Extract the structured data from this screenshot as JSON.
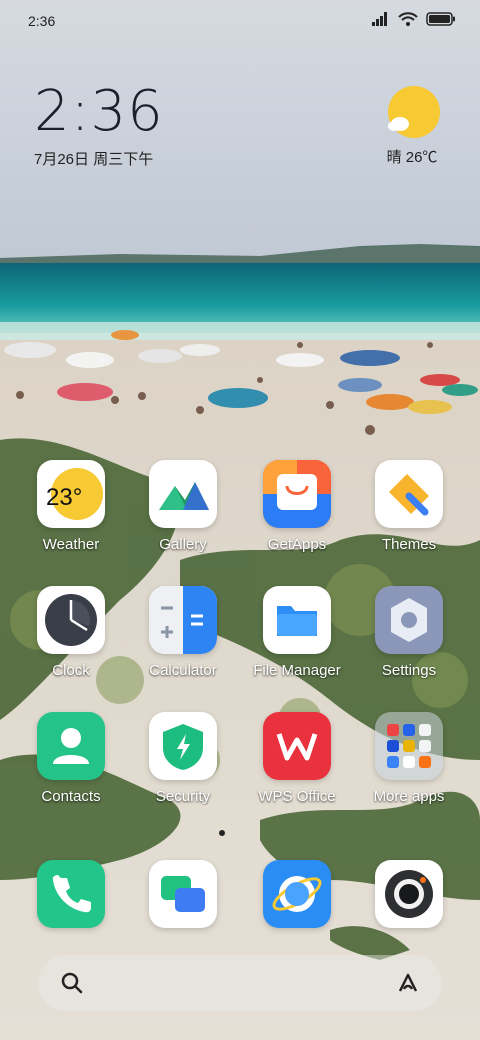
{
  "status": {
    "time": "2:36"
  },
  "clock": {
    "time": "2:36",
    "date": "7月26日 周三下午"
  },
  "weather": {
    "icon": "sun-cloud-icon",
    "text": "晴 26℃"
  },
  "apps": [
    {
      "label": "Weather",
      "icon": "weather-icon",
      "badge": "23°"
    },
    {
      "label": "Gallery",
      "icon": "gallery-icon"
    },
    {
      "label": "GetApps",
      "icon": "getapps-icon"
    },
    {
      "label": "Themes",
      "icon": "themes-icon"
    },
    {
      "label": "Clock",
      "icon": "clock-icon"
    },
    {
      "label": "Calculator",
      "icon": "calculator-icon"
    },
    {
      "label": "File Manager",
      "icon": "file-manager-icon"
    },
    {
      "label": "Settings",
      "icon": "settings-icon"
    },
    {
      "label": "Contacts",
      "icon": "contacts-icon"
    },
    {
      "label": "Security",
      "icon": "security-icon"
    },
    {
      "label": "WPS Office",
      "icon": "wps-office-icon"
    },
    {
      "label": "More apps",
      "icon": "folder-icon"
    }
  ],
  "dock": [
    {
      "label": "Phone",
      "icon": "phone-icon"
    },
    {
      "label": "Messages",
      "icon": "messages-icon"
    },
    {
      "label": "Browser",
      "icon": "browser-icon"
    },
    {
      "label": "Camera",
      "icon": "camera-icon"
    }
  ],
  "colors": {
    "weather_bg": "#f7c932",
    "gallery_mountain": "#1d9b5f",
    "getapps_orange": "#f9643b",
    "wps_red": "#e9323d",
    "contacts_green": "#23c38a",
    "phone_green": "#22c58a",
    "browser_blue": "#2a8cf5"
  }
}
